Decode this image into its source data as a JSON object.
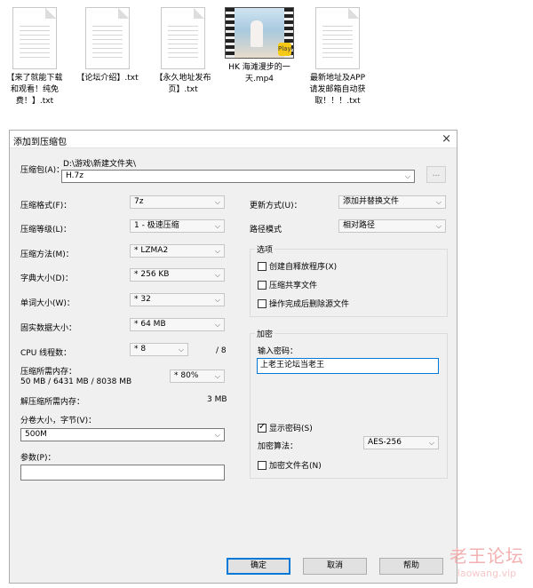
{
  "desktop": {
    "files": [
      {
        "name": "【来了就能下载和观看！纯免费！】.txt",
        "lines": [
          "【来了就能下载",
          "和观看！纯免",
          "费！】.txt"
        ],
        "type": "txt"
      },
      {
        "name": "【论坛介绍】.txt",
        "lines": [
          "【论坛介绍】.txt"
        ],
        "type": "txt"
      },
      {
        "name": "【永久地址发布页】.txt",
        "lines": [
          "【永久地址发布",
          "页】.txt"
        ],
        "type": "txt"
      },
      {
        "name": "HK 海滩漫步的一天.mp4",
        "lines": [
          "HK 海滩漫步的一",
          "天.mp4"
        ],
        "type": "mp4",
        "badge": "Player"
      },
      {
        "name": "最新地址及APP请发邮箱自动获取！！！.txt",
        "lines": [
          "最新地址及APP",
          "请发邮箱自动获",
          "取！！！.txt"
        ],
        "type": "txt"
      }
    ]
  },
  "dialog": {
    "title": "添加到压缩包",
    "close_icon": "×",
    "archive_label": "压缩包(A)：",
    "archive_path": "D:\\游戏\\新建文件夹\\",
    "archive_name": "H.7z",
    "browse_label": "...",
    "left": {
      "format_label": "压缩格式(F)：",
      "format_value": "7z",
      "level_label": "压缩等级(L)：",
      "level_value": "1 - 极速压缩",
      "method_label": "压缩方法(M)：",
      "method_value": "* LZMA2",
      "dict_label": "字典大小(D)：",
      "dict_value": "* 256 KB",
      "word_label": "单词大小(W)：",
      "word_value": "* 32",
      "solid_label": "固实数据大小：",
      "solid_value": "* 64 MB",
      "threads_label": "CPU 线程数：",
      "threads_value": "* 8",
      "threads_max": "/ 8",
      "mem_label": "压缩所需内存：",
      "mem_detail": "50 MB / 6431 MB / 8038 MB",
      "mem_percent": "* 80%",
      "decomp_label": "解压缩所需内存：",
      "decomp_value": "3 MB",
      "split_label": "分卷大小，字节(V)：",
      "split_value": "500M",
      "params_label": "参数(P)：",
      "params_value": ""
    },
    "right": {
      "update_label": "更新方式(U)：",
      "update_value": "添加并替换文件",
      "pathmode_label": "路径模式",
      "pathmode_value": "相对路径",
      "options_title": "选项",
      "opt_sfx": "创建自释放程序(X)",
      "opt_shared": "压缩共享文件",
      "opt_delete": "操作完成后删除源文件",
      "encrypt_title": "加密",
      "password_label": "输入密码：",
      "password_value": "上老王论坛当老王",
      "show_password": "显示密码(S)",
      "algo_label": "加密算法：",
      "algo_value": "AES-256",
      "encrypt_names": "加密文件名(N)"
    },
    "buttons": {
      "ok": "确定",
      "cancel": "取消",
      "help": "帮助"
    }
  },
  "watermark": {
    "line1": "老王论坛",
    "line2": "laowang.vip"
  }
}
